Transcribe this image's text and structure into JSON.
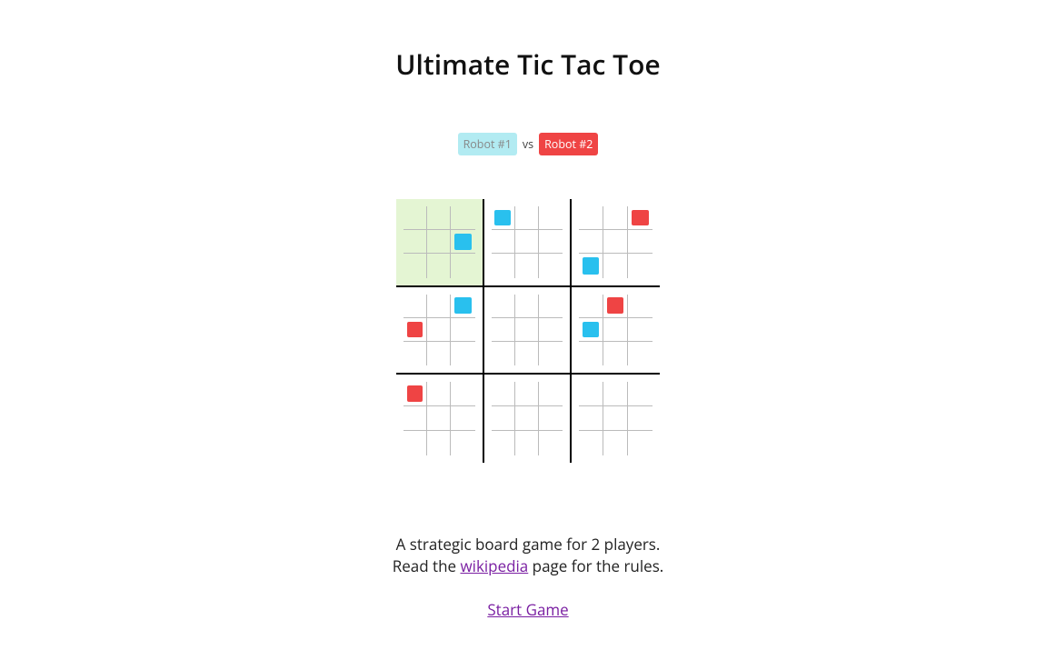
{
  "title": "Ultimate Tic Tac Toe",
  "players": {
    "p1": "Robot #1",
    "vs": "vs",
    "p2": "Robot #2"
  },
  "colors": {
    "player1_mark": "#29c0ee",
    "player2_mark": "#ef4444",
    "active_bg": "#e4f5d3"
  },
  "game": {
    "active_sub_board": 0,
    "current_turn": "p2",
    "sub_boards": [
      {
        "cells": [
          null,
          null,
          null,
          null,
          null,
          "p1",
          null,
          null,
          null
        ]
      },
      {
        "cells": [
          "p1",
          null,
          null,
          null,
          null,
          null,
          null,
          null,
          null
        ]
      },
      {
        "cells": [
          null,
          null,
          "p2",
          null,
          null,
          null,
          "p1",
          null,
          null
        ]
      },
      {
        "cells": [
          null,
          null,
          "p1",
          "p2",
          null,
          null,
          null,
          null,
          null
        ]
      },
      {
        "cells": [
          null,
          null,
          null,
          null,
          null,
          null,
          null,
          null,
          null
        ]
      },
      {
        "cells": [
          null,
          "p2",
          null,
          "p1",
          null,
          null,
          null,
          null,
          null
        ]
      },
      {
        "cells": [
          "p2",
          null,
          null,
          null,
          null,
          null,
          null,
          null,
          null
        ]
      },
      {
        "cells": [
          null,
          null,
          null,
          null,
          null,
          null,
          null,
          null,
          null
        ]
      },
      {
        "cells": [
          null,
          null,
          null,
          null,
          null,
          null,
          null,
          null,
          null
        ]
      }
    ]
  },
  "description": {
    "line1": "A strategic board game for 2 players.",
    "line2_pre": "Read the ",
    "line2_link": "wikipedia",
    "line2_post": " page for the rules."
  },
  "start_link": "Start Game"
}
